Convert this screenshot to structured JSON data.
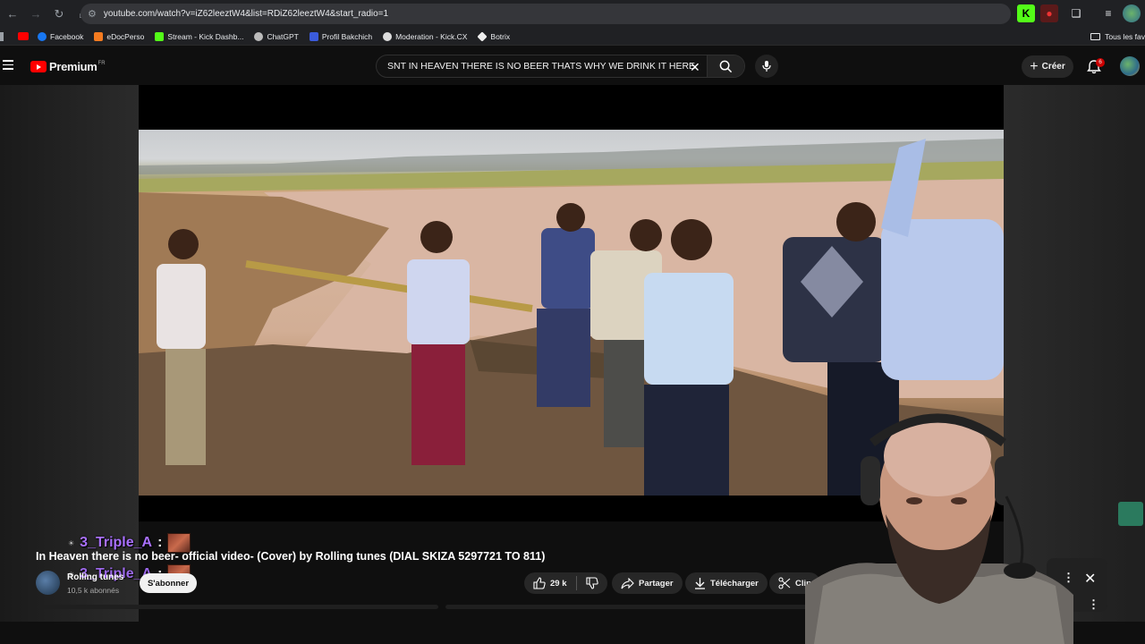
{
  "browser": {
    "url": "youtube.com/watch?v=iZ62leeztW4&list=RDiZ62leeztW4&start_radio=1",
    "nav_icons": [
      "back-icon",
      "forward-icon",
      "reload-icon",
      "home-icon"
    ],
    "bookmarks": [
      {
        "label": "Facebook",
        "color": "#1877f2"
      },
      {
        "label": "eDocPerso",
        "color": "#f47b20"
      },
      {
        "label": "Stream - Kick Dashb...",
        "color": "#53fc18"
      },
      {
        "label": "ChatGPT",
        "color": "#bbbbbb"
      },
      {
        "label": "Profil Bakchich",
        "color": "#3b5bdb"
      },
      {
        "label": "Moderation - Kick.CX",
        "color": "#dddddd"
      },
      {
        "label": "Botrix",
        "color": "#eeeeee"
      }
    ],
    "bookmarks_folder": "Tous les fav"
  },
  "youtube": {
    "logo_text": "Premium",
    "logo_region": "FR",
    "search_query": "SNT IN HEAVEN THERE IS NO BEER THATS WHY WE DRINK IT HERE",
    "create_label": "Créer",
    "notification_count": "6"
  },
  "video": {
    "title": "In Heaven there is no beer- official video- (Cover) by Rolling tunes (DIAL SKIZA 5297721 TO 811)",
    "channel_name": "Rolling tunes",
    "subscribers": "10,5 k abonnés",
    "subscribe_label": "S'abonner",
    "likes": "29 k",
    "share_label": "Partager",
    "download_label": "Télécharger",
    "clip_label": "Clip"
  },
  "chat_overlay": [
    {
      "username": "3_Triple_A",
      "separator": ":"
    },
    {
      "username": "3_Triple_A",
      "separator": ":"
    }
  ]
}
